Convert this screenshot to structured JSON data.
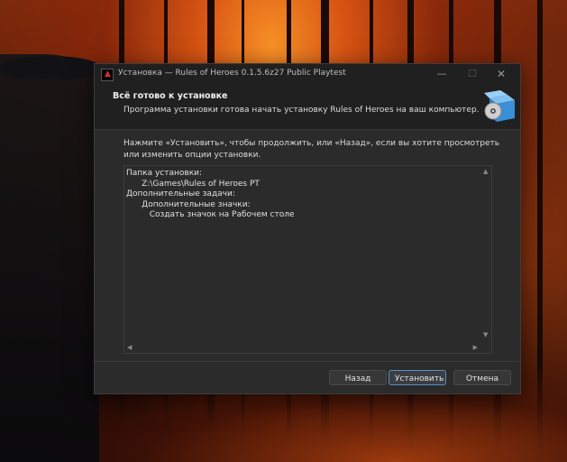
{
  "window": {
    "title": "Установка — Rules of Heroes 0.1.5.6z27 Public Playtest",
    "minimize_glyph": "—",
    "maximize_glyph": "☐",
    "close_glyph": "✕"
  },
  "header": {
    "heading": "Всё готово к установке",
    "subheading": "Программа установки готова начать установку Rules of Heroes на ваш компьютер."
  },
  "body": {
    "instructions": "Нажмите «Установить», чтобы продолжить, или «Назад», если вы хотите просмотреть или изменить опции установки."
  },
  "memo": {
    "lines": [
      "Папка установки:",
      "      Z:\\Games\\Rules of Heroes PT",
      "",
      "Дополнительные задачи:",
      "      Дополнительные значки:",
      "         Создать значок на Рабочем столе"
    ]
  },
  "buttons": {
    "back": "Назад",
    "install": "Установить",
    "cancel": "Отмена"
  },
  "icons": {
    "app": "rules-of-heroes-app-icon",
    "header": "setup-box-disc-icon"
  },
  "colors": {
    "window_bg": "#2b2b2b",
    "titlebar_bg": "#202020",
    "primary_button_border": "#5a8fc0",
    "icon_blue": "#3b8fd6"
  }
}
